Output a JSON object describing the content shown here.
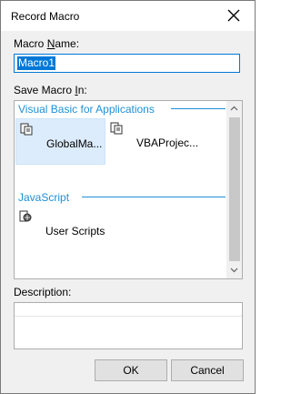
{
  "dialog": {
    "title": "Record Macro"
  },
  "macro_name": {
    "label_before": "Macro ",
    "label_accel": "N",
    "label_after": "ame:",
    "value": "Macro1"
  },
  "save_in": {
    "label_before": "Save Macro ",
    "label_accel": "I",
    "label_after": "n:"
  },
  "groups": [
    {
      "header": "Visual Basic for Applications",
      "items": [
        {
          "label": "GlobalMa...",
          "icon": "module-icon",
          "selected": true
        },
        {
          "label": "VBAProjec...",
          "icon": "module-icon",
          "selected": false
        }
      ]
    },
    {
      "header": "JavaScript",
      "items": [
        {
          "label": "User Scripts",
          "icon": "script-icon",
          "selected": false
        }
      ]
    }
  ],
  "description": {
    "label": "Description:",
    "value": ""
  },
  "buttons": {
    "ok": "OK",
    "cancel": "Cancel"
  },
  "colors": {
    "accent": "#0078d7",
    "group_header": "#1e90d6",
    "selected_bg": "#dcecfc"
  }
}
